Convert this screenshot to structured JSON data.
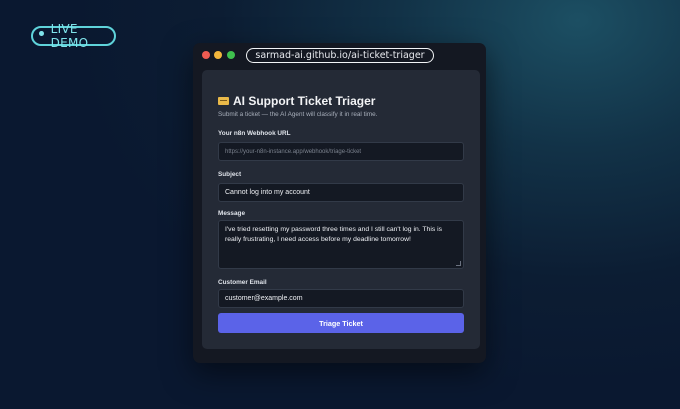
{
  "badge": {
    "label": "LIVE DEMO"
  },
  "browser": {
    "url": "sarmad-ai.github.io/ai-ticket-triager"
  },
  "app": {
    "title": "AI Support Ticket Triager",
    "subtitle": "Submit a ticket — the AI Agent will classify it in real time.",
    "webhook": {
      "label": "Your n8n Webhook URL",
      "placeholder": "https://your-n8n-instance.app/webhook/triage-ticket"
    },
    "subject": {
      "label": "Subject",
      "value": "Cannot log into my account"
    },
    "message": {
      "label": "Message",
      "value": "I've tried resetting my password three times and I still can't log in. This is really frustrating, I need access before my deadline tomorrow!"
    },
    "email": {
      "label": "Customer Email",
      "value": "customer@example.com"
    },
    "submit_label": "Triage Ticket"
  },
  "colors": {
    "accent": "#5b63e8",
    "badge": "#5fd3da",
    "card": "#242a36"
  }
}
